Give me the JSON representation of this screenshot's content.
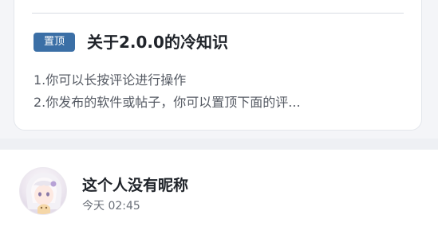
{
  "pinned_post": {
    "badge": "置顶",
    "title": "关于2.0.0的冷知识",
    "lines": [
      "1.你可以长按评论进行操作",
      "2.你发布的软件或帖子，你可以置顶下面的评..."
    ]
  },
  "comment": {
    "avatar_icon": "anime-avatar-icon",
    "nickname": "这个人没有昵称",
    "time": "今天 02:45"
  },
  "colors": {
    "badge_bg": "#3b6fa6",
    "title_text": "#1f2329",
    "body_text": "#555a63",
    "page_bg": "#f4f5f8"
  }
}
